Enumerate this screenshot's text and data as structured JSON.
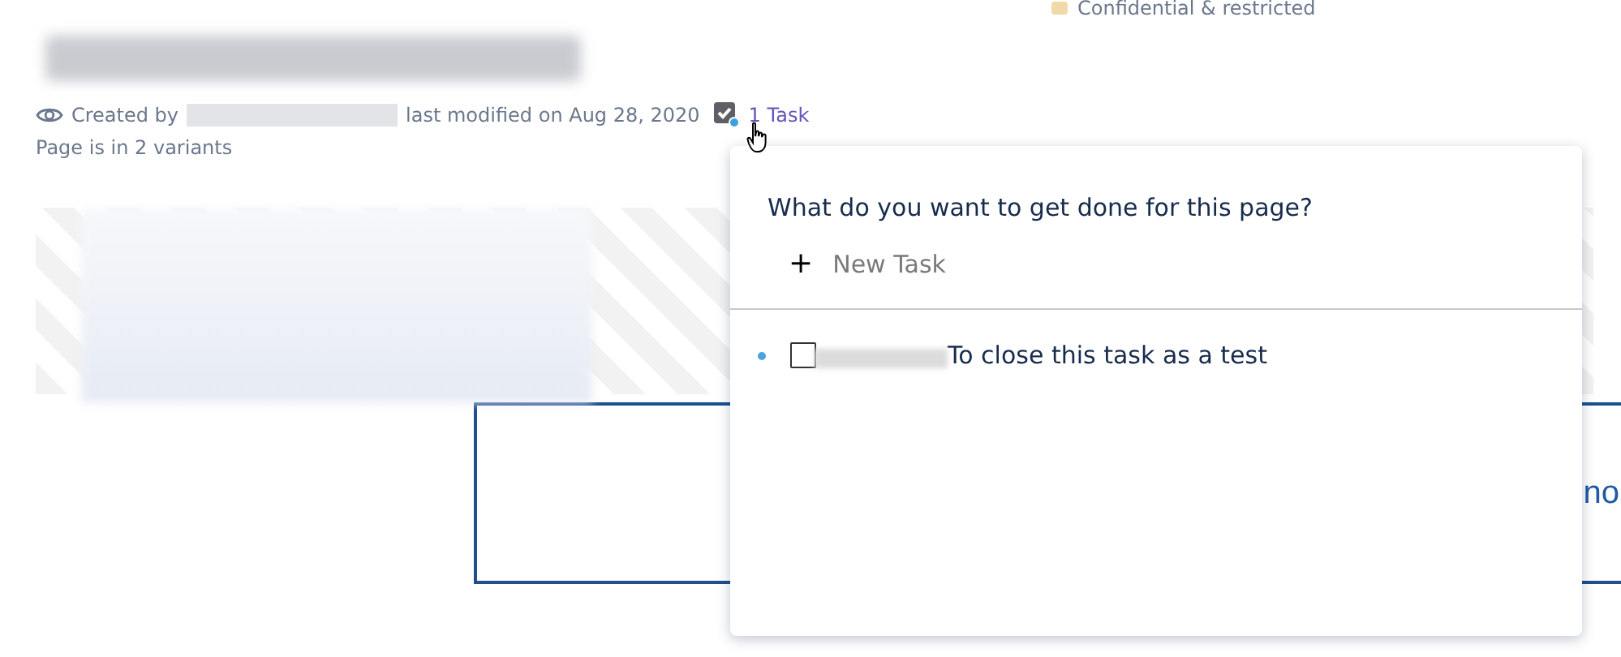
{
  "page": {
    "classification": "Confidential & restricted",
    "byline": {
      "created_by_label": "Created by",
      "modified": "last modified on Aug 28, 2020",
      "tasks_link": "1 Task"
    },
    "variants": "Page is in 2 variants"
  },
  "content_box": {
    "text": "no"
  },
  "tasks_popup": {
    "prompt": "What do you want to get done for this page?",
    "new_task": {
      "icon_text": "+",
      "label": "New Task"
    },
    "tasks": [
      {
        "unread": true,
        "checked": false,
        "text": "To close this task as a test"
      }
    ]
  }
}
